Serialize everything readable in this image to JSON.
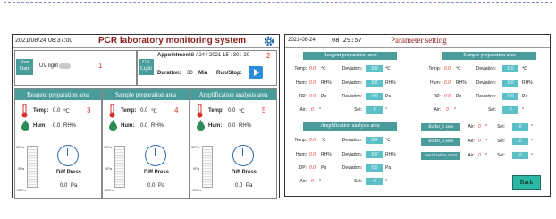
{
  "left": {
    "datetime": "2021/08/24  08:37:00",
    "title": "PCR laboratory monitoring system",
    "run_state_label": "Run State",
    "uv_light_label": "UV light",
    "marker1": "1",
    "uv_light2_label": "UV Light",
    "appointment_label": "Appointment:",
    "appointment_value": "8 / 24 / 2021   15 : 30 : 20",
    "marker2": "2",
    "duration_label": "Duration:",
    "duration_value": "30",
    "duration_unit": "Min",
    "run_stop_label": "Run/Stop:",
    "sections": [
      {
        "title": "Reagent preparation area",
        "temp_label": "Temp:",
        "temp_value": "0.0",
        "temp_unit": "℃",
        "marker": "3",
        "hum_label": "Hum:",
        "hum_value": "0.0",
        "hum_unit": "RH%",
        "scale_top": "30Pa",
        "scale_mid": "0Pa",
        "scale_bot": "-30Pa",
        "diff_label": "Diff Press",
        "diff_value": "0.0",
        "diff_unit": "Pa"
      },
      {
        "title": "Sample preparation area",
        "temp_label": "Temp:",
        "temp_value": "0.0",
        "temp_unit": "℃",
        "marker": "4",
        "hum_label": "Hum:",
        "hum_value": "0.0",
        "hum_unit": "RH%",
        "scale_top": "30Pa",
        "scale_mid": "0Pa",
        "scale_bot": "-30Pa",
        "diff_label": "Diff Press",
        "diff_value": "0.0",
        "diff_unit": "Pa"
      },
      {
        "title": "Amplification analysis area",
        "temp_label": "Temp:",
        "temp_value": "0.0",
        "temp_unit": "℃",
        "marker": "5",
        "hum_label": "Hum:",
        "hum_value": "0.0",
        "hum_unit": "RH%",
        "scale_top": "30Pa",
        "scale_mid": "0Pa",
        "scale_bot": "-30Pa",
        "diff_label": "Diff Press",
        "diff_value": "0.0",
        "diff_unit": "Pa"
      }
    ]
  },
  "right": {
    "date": "2021-08-24",
    "time": "08:29:57",
    "title": "Parameter setting",
    "reagent_title": "Reagent preparation area",
    "sample_title": "Sample preparation area",
    "amp_title": "Amplification analysis area",
    "temp": "Temp:",
    "hum": "Hum:",
    "dp": "DP:",
    "air": "Air:",
    "deviation": "Deviation:",
    "set": "Set:",
    "zero": "0.0",
    "zero_int": "0",
    "unit_c": "℃",
    "unit_rh": "RH%",
    "unit_pa": "Pa",
    "unit_deg": "°",
    "buffer1": "Buffer_1 area",
    "buffer2": "Buffer_2 area",
    "steril": "Sterilization room",
    "back": "Back"
  }
}
